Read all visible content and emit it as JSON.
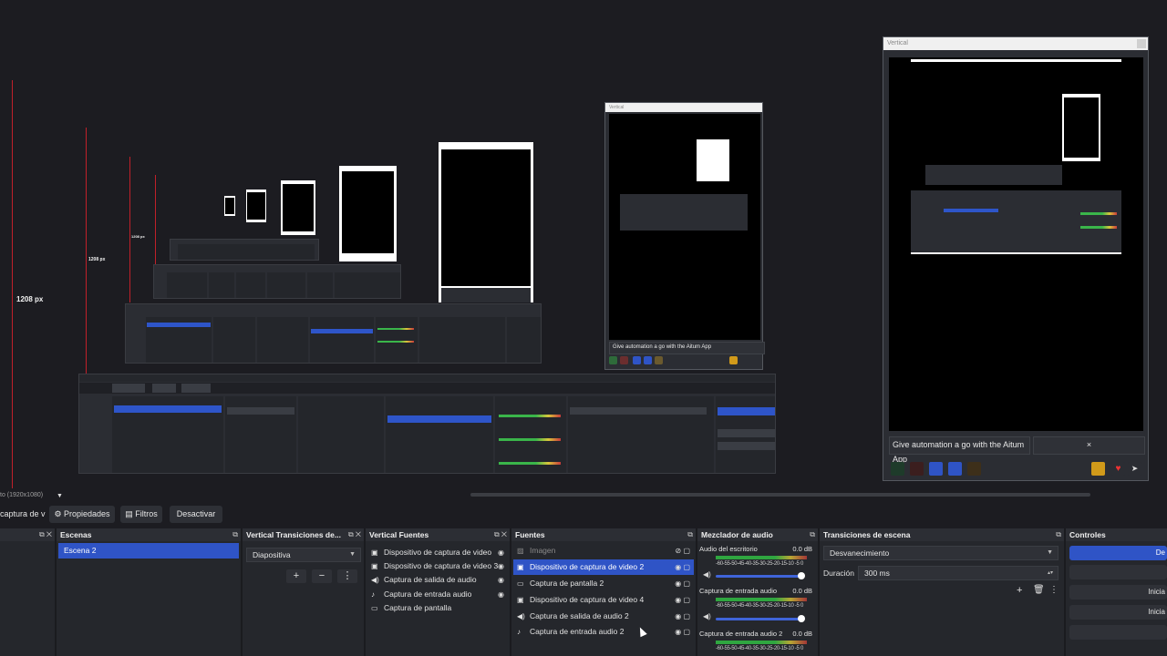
{
  "preview": {
    "height_label_main": "1208 px",
    "height_label_mid": "1208 px",
    "height_label_small": "1208 px",
    "vertical_window_title": "Vertical",
    "vertical_input_text": "Give automation a go with the Aitum App",
    "vertical_input_close": "×",
    "small_window_title": "Vertical",
    "small_input_text": "Give automation a go with the Aitum App",
    "resolution_label": "to (1920x1080)"
  },
  "toolbar": {
    "capture_label": "captura de v",
    "properties_label": "Propiedades",
    "filters_label": "Filtros",
    "deactivate_label": "Desactivar"
  },
  "docks": {
    "scenes": {
      "title": "Escenas",
      "items": [
        "Escena 2"
      ]
    },
    "vertical_transitions": {
      "title": "Vertical Transiciones de...",
      "selected": "Diapositiva"
    },
    "vertical_sources": {
      "title": "Vertical Fuentes",
      "items": [
        "Dispositivo de captura de video",
        "Dispositivo de captura de video 3",
        "Captura de salida de audio",
        "Captura de entrada audio",
        "Captura de pantalla"
      ]
    },
    "sources": {
      "title": "Fuentes",
      "items": [
        "Imagen",
        "Dispositivo de captura de video 2",
        "Captura de pantalla 2",
        "Dispositivo de captura de video 4",
        "Captura de salida de audio 2",
        "Captura de entrada audio 2"
      ]
    },
    "mixer": {
      "title": "Mezclador de audio",
      "channels": [
        {
          "name": "Audio del escritorio",
          "db": "0.0 dB"
        },
        {
          "name": "Captura de entrada audio",
          "db": "0.0 dB"
        },
        {
          "name": "Captura de entrada audio 2",
          "db": "0.0 dB"
        }
      ],
      "scale": "-60-55-50-45-40-35-30-25-20-15-10 -5  0"
    },
    "scene_transitions": {
      "title": "Transiciones de escena",
      "selected": "Desvanecimiento",
      "duration_label": "Duración",
      "duration_value": "300 ms"
    },
    "controls": {
      "title": "Controles",
      "buttons": [
        "De",
        "",
        "Inicia",
        "Inicia",
        ""
      ]
    }
  },
  "colors": {
    "accent": "#2f54c6",
    "background": "#1c1c21",
    "dock": "#25272c",
    "red_guide": "#c0202a"
  },
  "icons": [
    "eye-icon",
    "lock-icon",
    "gear-icon",
    "filter-icon",
    "close-icon",
    "undock-icon",
    "speaker-icon",
    "mic-icon",
    "monitor-icon",
    "camera-icon",
    "image-icon",
    "plus-icon",
    "minus-icon",
    "more-icon",
    "trash-icon"
  ]
}
